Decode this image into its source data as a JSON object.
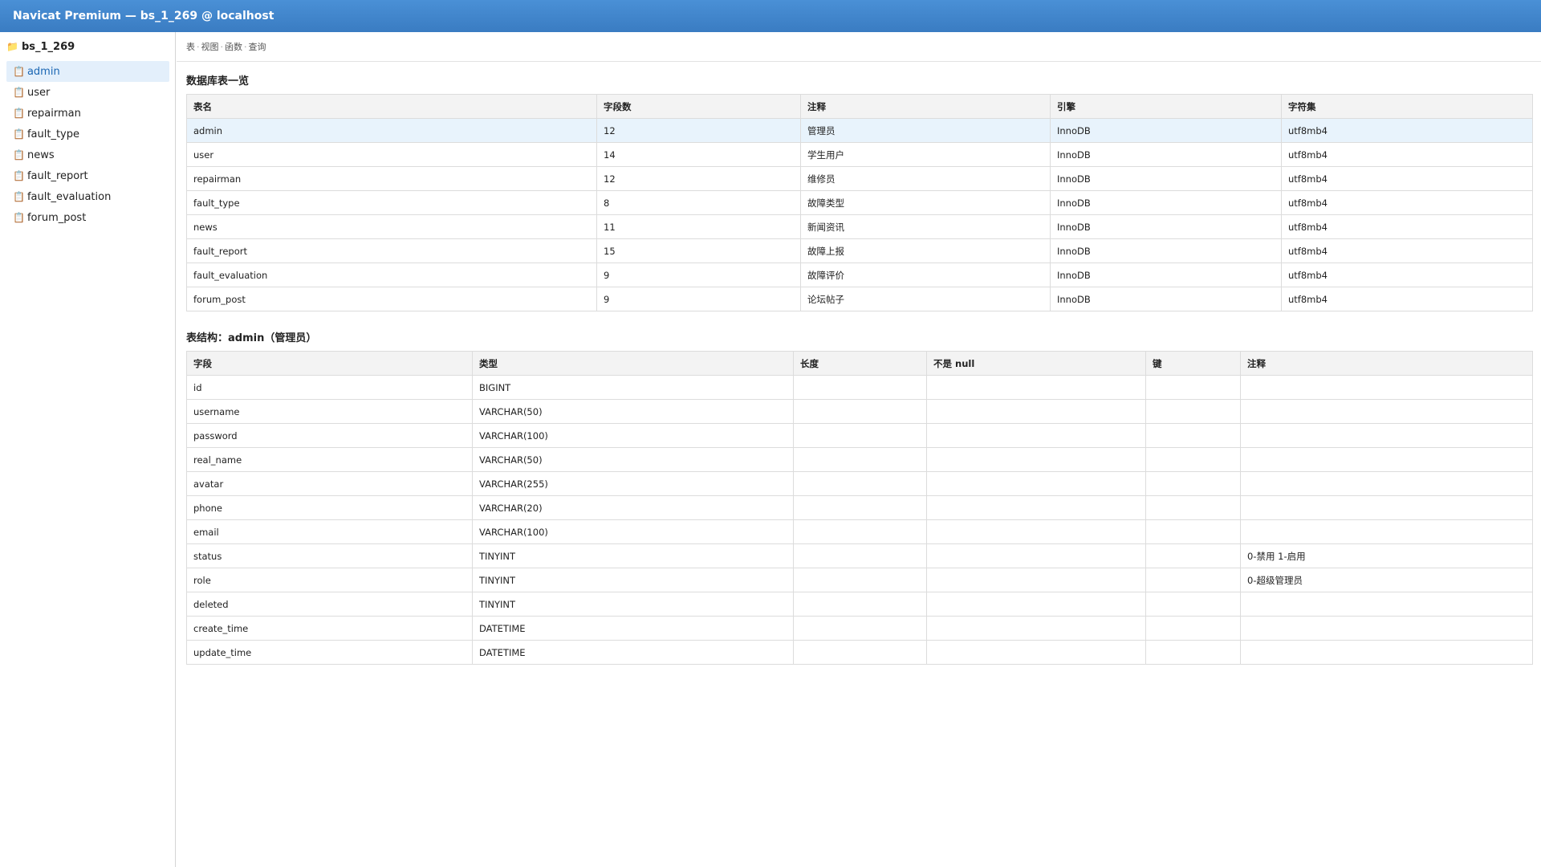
{
  "window": {
    "title": "Navicat Premium — bs_1_269 @ localhost"
  },
  "sidebar": {
    "database": "bs_1_269",
    "database_icon": "folder-icon",
    "item_icon": "table-icon",
    "items": [
      {
        "label": "admin",
        "active": true
      },
      {
        "label": "user"
      },
      {
        "label": "repairman"
      },
      {
        "label": "fault_type"
      },
      {
        "label": "news"
      },
      {
        "label": "fault_report"
      },
      {
        "label": "fault_evaluation"
      },
      {
        "label": "forum_post"
      }
    ]
  },
  "breadcrumb": [
    "表",
    "视图",
    "函数",
    "查询"
  ],
  "tables_overview": {
    "title": "数据库表一览",
    "columns": [
      "表名",
      "字段数",
      "注释",
      "引擎",
      "字符集"
    ],
    "rows": [
      [
        "admin",
        "12",
        "管理员",
        "InnoDB",
        "utf8mb4"
      ],
      [
        "user",
        "14",
        "学生用户",
        "InnoDB",
        "utf8mb4"
      ],
      [
        "repairman",
        "12",
        "维修员",
        "InnoDB",
        "utf8mb4"
      ],
      [
        "fault_type",
        "8",
        "故障类型",
        "InnoDB",
        "utf8mb4"
      ],
      [
        "news",
        "11",
        "新闻资讯",
        "InnoDB",
        "utf8mb4"
      ],
      [
        "fault_report",
        "15",
        "故障上报",
        "InnoDB",
        "utf8mb4"
      ],
      [
        "fault_evaluation",
        "9",
        "故障评价",
        "InnoDB",
        "utf8mb4"
      ],
      [
        "forum_post",
        "9",
        "论坛帖子",
        "InnoDB",
        "utf8mb4"
      ]
    ]
  },
  "structure": {
    "title": "表结构：admin（管理员）",
    "columns": [
      "字段",
      "类型",
      "长度",
      "不是 null",
      "键",
      "注释"
    ],
    "rows": [
      [
        "id",
        "BIGINT",
        "",
        "",
        "",
        ""
      ],
      [
        "username",
        "VARCHAR(50)",
        "",
        "",
        "",
        ""
      ],
      [
        "password",
        "VARCHAR(100)",
        "",
        "",
        "",
        ""
      ],
      [
        "real_name",
        "VARCHAR(50)",
        "",
        "",
        "",
        ""
      ],
      [
        "avatar",
        "VARCHAR(255)",
        "",
        "",
        "",
        ""
      ],
      [
        "phone",
        "VARCHAR(20)",
        "",
        "",
        "",
        ""
      ],
      [
        "email",
        "VARCHAR(100)",
        "",
        "",
        "",
        ""
      ],
      [
        "status",
        "TINYINT",
        "",
        "",
        "",
        "0-禁用 1-启用"
      ],
      [
        "role",
        "TINYINT",
        "",
        "",
        "",
        "0-超级管理员"
      ],
      [
        "deleted",
        "TINYINT",
        "",
        "",
        "",
        ""
      ],
      [
        "create_time",
        "DATETIME",
        "",
        "",
        "",
        ""
      ],
      [
        "update_time",
        "DATETIME",
        "",
        "",
        "",
        ""
      ]
    ]
  },
  "colors": {
    "titlebar": "#3a7cc2",
    "selected_row": "#e8f3fc",
    "active_item": "#1a66b3"
  }
}
